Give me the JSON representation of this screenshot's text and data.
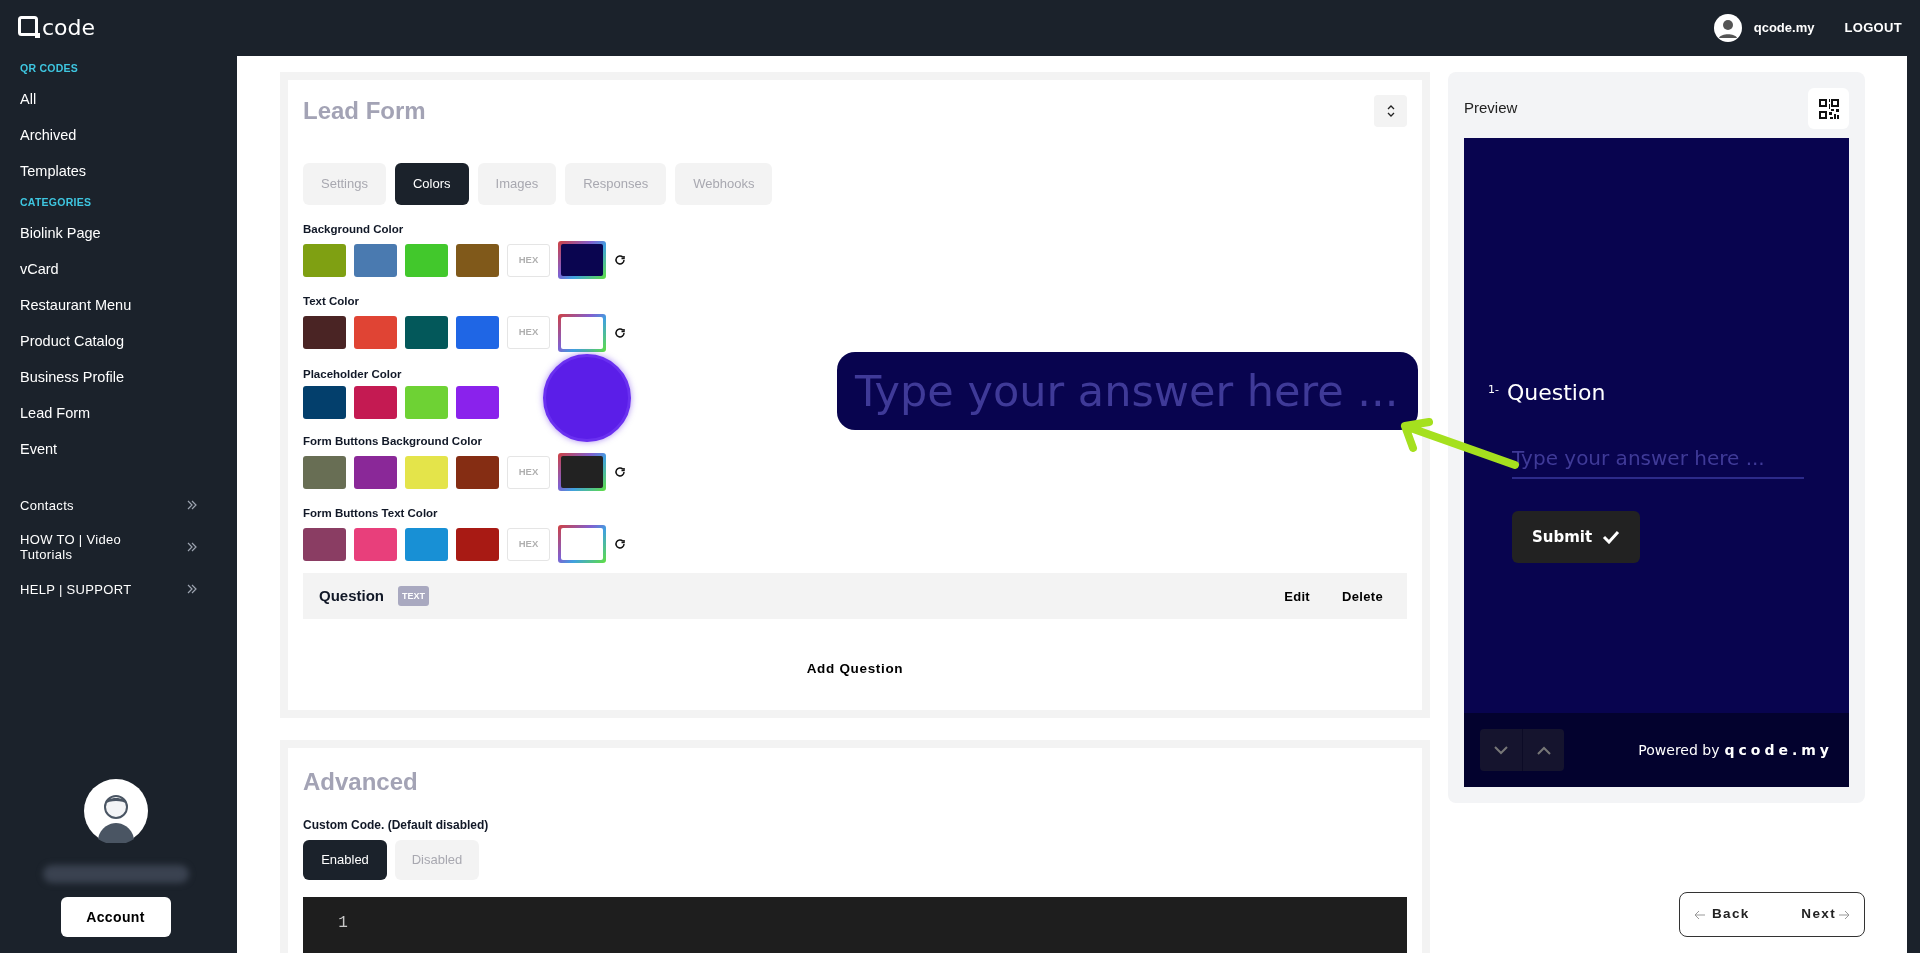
{
  "header": {
    "logo": "code",
    "user": "qcode.my",
    "logout": "LOGOUT"
  },
  "sidebar": {
    "sections": [
      {
        "title": "QR CODES",
        "items": [
          "All",
          "Archived",
          "Templates"
        ]
      },
      {
        "title": "CATEGORIES",
        "items": [
          "Biolink Page",
          "vCard",
          "Restaurant Menu",
          "Product Catalog",
          "Business Profile",
          "Lead Form",
          "Event"
        ]
      }
    ],
    "links": [
      "Contacts",
      "HOW TO | Video Tutorials",
      "HELP | SUPPORT"
    ],
    "account": "Account"
  },
  "lead_form": {
    "title": "Lead Form",
    "tabs": [
      {
        "label": "Settings",
        "selected": false
      },
      {
        "label": "Colors",
        "selected": true
      },
      {
        "label": "Images",
        "selected": false
      },
      {
        "label": "Responses",
        "selected": false
      },
      {
        "label": "Webhooks",
        "selected": false
      }
    ],
    "color_rows": [
      {
        "label": "Background Color",
        "swatches": [
          {
            "color": "#7fa012"
          },
          {
            "color": "#4a7ab0"
          },
          {
            "color": "#42c82c"
          },
          {
            "color": "#80591a"
          }
        ],
        "hex": "HEX",
        "picker": {
          "color": "#0a0550"
        }
      },
      {
        "label": "Text Color",
        "swatches": [
          {
            "color": "#4a2424"
          },
          {
            "color": "#e04434"
          },
          {
            "color": "#03585a"
          },
          {
            "color": "#1f66e5"
          }
        ],
        "hex": "HEX",
        "picker": {
          "color": "#ffffff"
        }
      },
      {
        "label": "Placeholder Color",
        "swatches": [
          {
            "color": "#033f6c"
          },
          {
            "color": "#c41a52"
          },
          {
            "color": "#6ed234"
          },
          {
            "color": "#8a22ec"
          }
        ]
      },
      {
        "label": "Form Buttons Background Color",
        "swatches": [
          {
            "color": "#686e54"
          },
          {
            "color": "#8a2898"
          },
          {
            "color": "#e4e44a"
          },
          {
            "color": "#852d13"
          }
        ],
        "hex": "HEX",
        "picker": {
          "color": "#222222"
        }
      },
      {
        "label": "Form Buttons Text Color",
        "swatches": [
          {
            "color": "#8a3d63"
          },
          {
            "color": "#e83f7b"
          },
          {
            "color": "#1890d5"
          },
          {
            "color": "#a81a14"
          }
        ],
        "hex": "HEX",
        "picker": {
          "color": "#ffffff"
        }
      }
    ],
    "question": {
      "title": "Question",
      "badge": "TEXT",
      "edit": "Edit",
      "delete": "Delete"
    },
    "add_question": "Add Question"
  },
  "advanced": {
    "title": "Advanced",
    "custom_code_label": "Custom Code. (Default disabled)",
    "options": [
      {
        "label": "Enabled",
        "selected": true
      },
      {
        "label": "Disabled",
        "selected": false
      }
    ],
    "line_numbers": [
      "1"
    ]
  },
  "preview": {
    "title": "Preview",
    "question_number": "1-",
    "question": "Question",
    "placeholder": "Type your answer here ...",
    "submit": "Submit",
    "powered_by": "Powered by",
    "brand": "qcode.my"
  },
  "callout": {
    "placeholder": "Type your answer here ..."
  },
  "nav": {
    "back": "Back",
    "next": "Next"
  }
}
